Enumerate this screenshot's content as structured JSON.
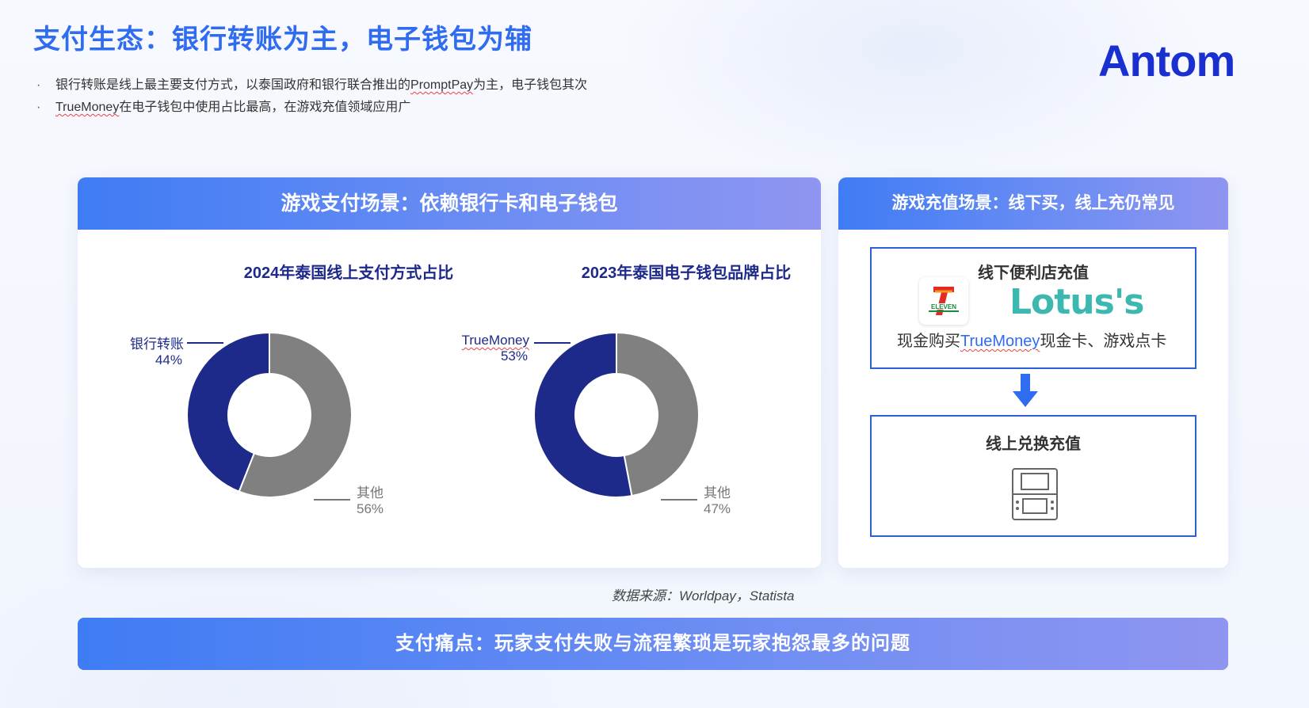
{
  "title": "支付生态：银行转账为主，电子钱包为辅",
  "bullets": [
    {
      "pre": "银行转账是线上最主要支付方式，以泰国政府和银行联合推出的",
      "term": "PromptPay",
      "post": "为主，电子钱包其次"
    },
    {
      "pre": "",
      "term": "TrueMoney",
      "post": "在电子钱包中使用占比最高，在游戏充值领域应用广"
    }
  ],
  "logo": {
    "text": "Antom",
    "color": "#1a2fd0"
  },
  "left_card": {
    "header": "游戏支付场景：依赖银行卡和电子钱包"
  },
  "right_card": {
    "header": "游戏充值场景：线下买，线上充仍常见",
    "offline_box": {
      "title": "线下便利店充值",
      "seven_eleven_text": "ELEVEN",
      "lotus_text": "Lotus's",
      "desc_pre": "现金购买",
      "desc_term": "TrueMoney",
      "desc_post": "现金卡、游戏点卡"
    },
    "arrow_icon": "arrow-down-icon",
    "online_box": {
      "title": "线上兑换充值",
      "icon": "handheld-console-icon"
    }
  },
  "source": "数据来源：Worldpay，Statista",
  "banner": "支付痛点：玩家支付失败与流程繁琐是玩家抱怨最多的问题",
  "colors": {
    "primary": "#1e2a8a",
    "other": "#808080",
    "accent": "#2f6cf0"
  },
  "chart_data": [
    {
      "type": "pie",
      "title": "2024年泰国线上支付方式占比",
      "series": [
        {
          "name": "银行转账",
          "value": 44,
          "label": "44%",
          "color": "#1e2a8a"
        },
        {
          "name": "其他",
          "value": 56,
          "label": "56%",
          "color": "#808080"
        }
      ],
      "donut": true
    },
    {
      "type": "pie",
      "title": "2023年泰国电子钱包品牌占比",
      "series": [
        {
          "name": "TrueMoney",
          "value": 53,
          "label": "53%",
          "color": "#1e2a8a"
        },
        {
          "name": "其他",
          "value": 47,
          "label": "47%",
          "color": "#808080"
        }
      ],
      "donut": true
    }
  ]
}
